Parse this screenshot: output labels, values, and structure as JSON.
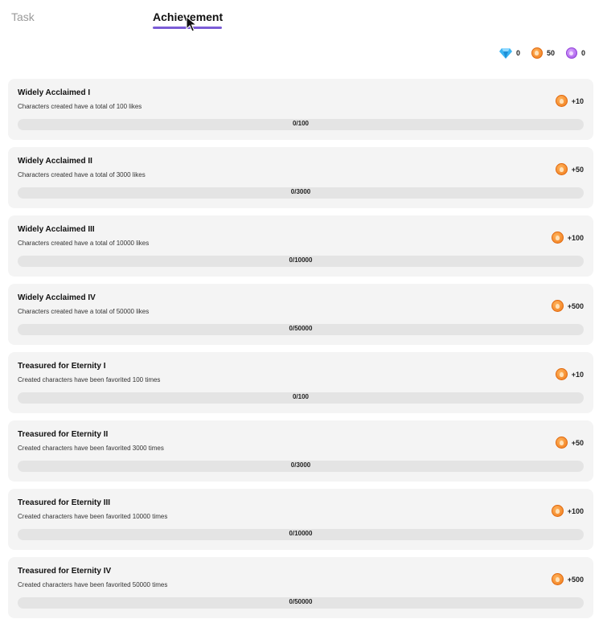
{
  "tabs": [
    {
      "label": "Task",
      "active": false
    },
    {
      "label": "Achievement",
      "active": true
    }
  ],
  "currencies": [
    {
      "icon": "diamond-icon",
      "value": "0",
      "color": "#3ab4f2"
    },
    {
      "icon": "orange-coin-icon",
      "value": "50",
      "color": "#f28a22"
    },
    {
      "icon": "purple-coin-icon",
      "value": "0",
      "color": "#b063ef"
    }
  ],
  "accent_color": "#7b5cd6",
  "achievements": [
    {
      "title": "Widely Acclaimed I",
      "description": "Characters created have a total of 100 likes",
      "reward": "+10",
      "current": 0,
      "target": 100,
      "progress_text": "0/100"
    },
    {
      "title": "Widely Acclaimed II",
      "description": "Characters created have a total of 3000 likes",
      "reward": "+50",
      "current": 0,
      "target": 3000,
      "progress_text": "0/3000"
    },
    {
      "title": "Widely Acclaimed III",
      "description": "Characters created have a total of 10000 likes",
      "reward": "+100",
      "current": 0,
      "target": 10000,
      "progress_text": "0/10000"
    },
    {
      "title": "Widely Acclaimed IV",
      "description": "Characters created have a total of 50000 likes",
      "reward": "+500",
      "current": 0,
      "target": 50000,
      "progress_text": "0/50000"
    },
    {
      "title": "Treasured for Eternity I",
      "description": "Created characters have been favorited 100 times",
      "reward": "+10",
      "current": 0,
      "target": 100,
      "progress_text": "0/100"
    },
    {
      "title": "Treasured for Eternity II",
      "description": "Created characters have been favorited 3000 times",
      "reward": "+50",
      "current": 0,
      "target": 3000,
      "progress_text": "0/3000"
    },
    {
      "title": "Treasured for Eternity III",
      "description": "Created characters have been favorited 10000 times",
      "reward": "+100",
      "current": 0,
      "target": 10000,
      "progress_text": "0/10000"
    },
    {
      "title": "Treasured for Eternity IV",
      "description": "Created characters have been favorited 50000 times",
      "reward": "+500",
      "current": 0,
      "target": 50000,
      "progress_text": "0/50000"
    }
  ]
}
